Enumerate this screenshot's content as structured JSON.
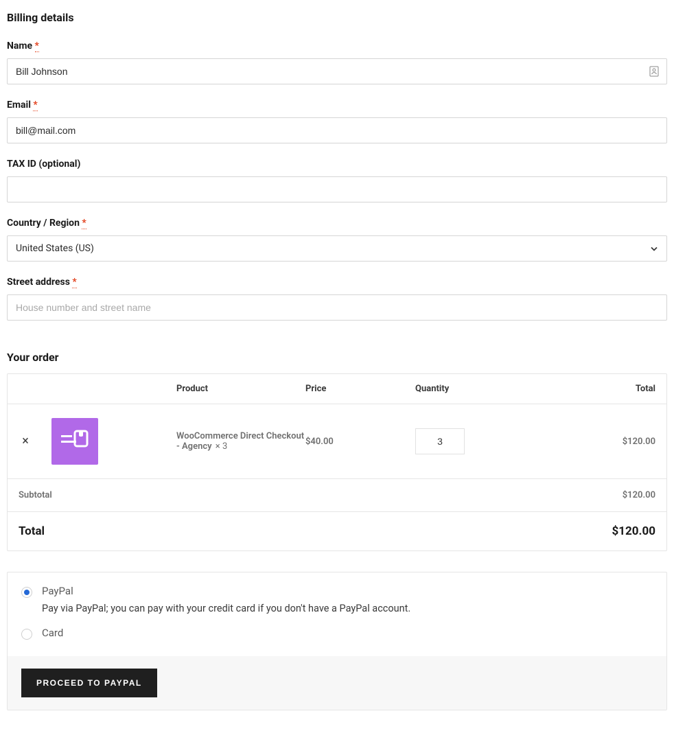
{
  "billing": {
    "heading": "Billing details",
    "name_label": "Name",
    "name_value": "Bill Johnson",
    "email_label": "Email",
    "email_value": "bill@mail.com",
    "tax_label": "TAX ID (optional)",
    "tax_value": "",
    "country_label": "Country / Region",
    "country_value": "United States (US)",
    "street_label": "Street address",
    "street_placeholder": "House number and street name",
    "street_value": "",
    "required_mark": "*"
  },
  "order": {
    "heading": "Your order",
    "headers": {
      "product": "Product",
      "price": "Price",
      "quantity": "Quantity",
      "total": "Total"
    },
    "items": [
      {
        "name": "WooCommerce Direct Checkout - Agency",
        "qty_display": "× 3",
        "price": "$40.00",
        "qty_value": "3",
        "line_total": "$120.00"
      }
    ],
    "subtotal_label": "Subtotal",
    "subtotal_value": "$120.00",
    "total_label": "Total",
    "total_value": "$120.00"
  },
  "payment": {
    "options": [
      {
        "label": "PayPal",
        "desc": "Pay via PayPal; you can pay with your credit card if you don't have a PayPal account.",
        "selected": true
      },
      {
        "label": "Card",
        "selected": false
      }
    ],
    "proceed_label": "Proceed to PayPal"
  }
}
